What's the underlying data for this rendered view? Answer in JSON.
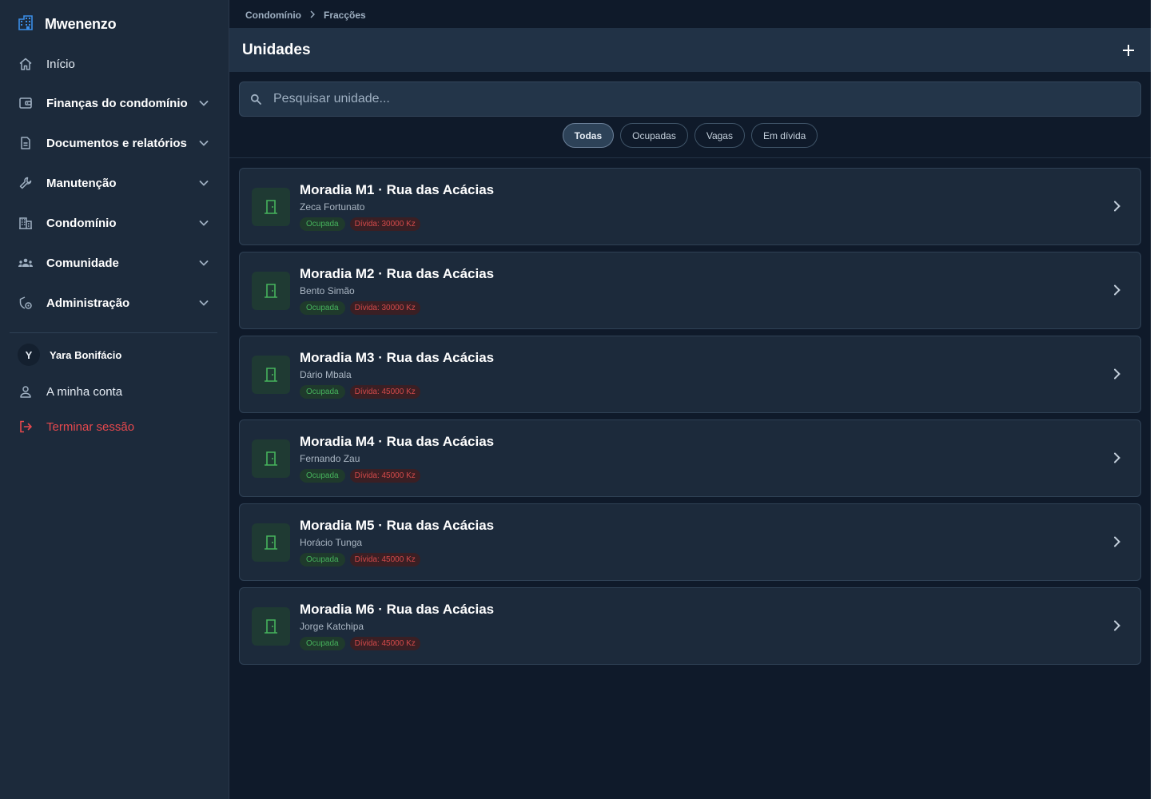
{
  "app": {
    "brand": "Mwenenzo"
  },
  "sidebar": {
    "items": [
      {
        "label": "Início",
        "icon": "home-icon",
        "expandable": false
      },
      {
        "label": "Finanças do condomínio",
        "icon": "wallet-icon",
        "expandable": true
      },
      {
        "label": "Documentos e relatórios",
        "icon": "document-icon",
        "expandable": true
      },
      {
        "label": "Manutenção",
        "icon": "wrench-icon",
        "expandable": true
      },
      {
        "label": "Condomínio",
        "icon": "building-icon",
        "expandable": true
      },
      {
        "label": "Comunidade",
        "icon": "people-icon",
        "expandable": true
      },
      {
        "label": "Administração",
        "icon": "admin-settings-icon",
        "expandable": true
      }
    ],
    "user": {
      "initial": "Y",
      "name": "Yara Bonifácio"
    },
    "account_label": "A minha conta",
    "logout_label": "Terminar sessão"
  },
  "breadcrumb": [
    "Condomínio",
    "Fracções"
  ],
  "header": {
    "title": "Unidades"
  },
  "search": {
    "placeholder": "Pesquisar unidade...",
    "value": ""
  },
  "filters": [
    {
      "label": "Todas",
      "active": true
    },
    {
      "label": "Ocupadas",
      "active": false
    },
    {
      "label": "Vagas",
      "active": false
    },
    {
      "label": "Em dívida",
      "active": false
    }
  ],
  "units": [
    {
      "title": "Moradia M1 · Rua das Acácias",
      "resident": "Zeca Fortunato",
      "status": "Ocupada",
      "debt": "Dívida: 30000 Kz"
    },
    {
      "title": "Moradia M2 · Rua das Acácias",
      "resident": "Bento Simão",
      "status": "Ocupada",
      "debt": "Dívida: 30000 Kz"
    },
    {
      "title": "Moradia M3 · Rua das Acácias",
      "resident": "Dário Mbala",
      "status": "Ocupada",
      "debt": "Dívida: 45000 Kz"
    },
    {
      "title": "Moradia M4 · Rua das Acácias",
      "resident": "Fernando Zau",
      "status": "Ocupada",
      "debt": "Dívida: 45000 Kz"
    },
    {
      "title": "Moradia M5 · Rua das Acácias",
      "resident": "Horácio Tunga",
      "status": "Ocupada",
      "debt": "Dívida: 45000 Kz"
    },
    {
      "title": "Moradia M6 · Rua das Acácias",
      "resident": "Jorge Katchipa",
      "status": "Ocupada",
      "debt": "Dívida: 45000 Kz"
    }
  ],
  "colors": {
    "accent_blue": "#3b8ee8",
    "occupied_green": "#46b35c",
    "debt_red": "#d34a4a",
    "logout_red": "#e5484d"
  }
}
